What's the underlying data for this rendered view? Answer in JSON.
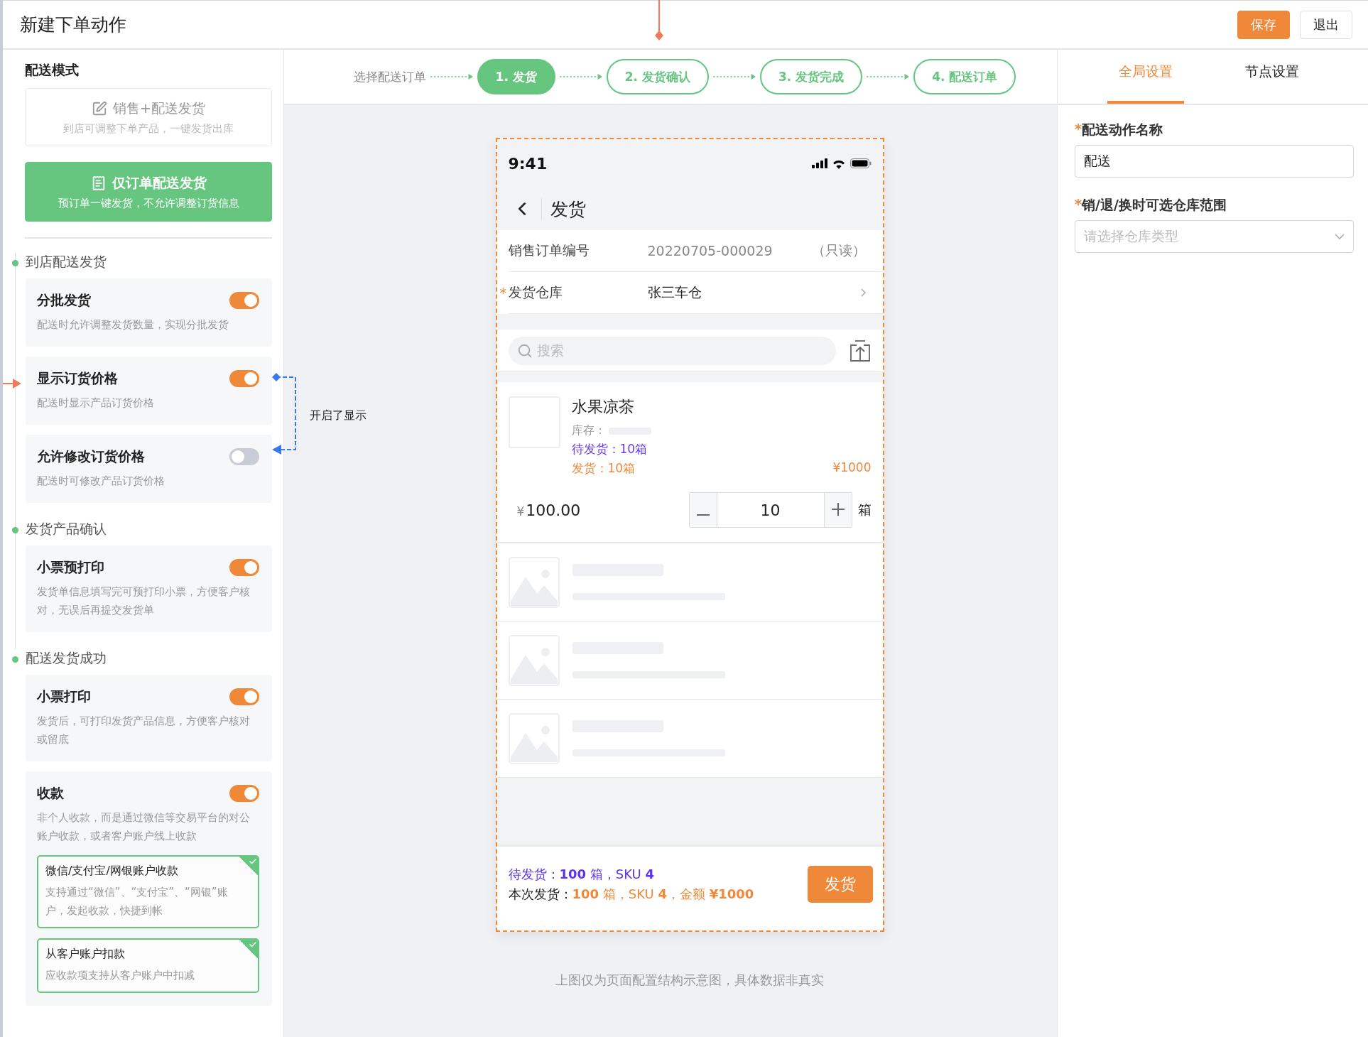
{
  "header": {
    "title": "新建下单动作",
    "buttons": [
      {
        "label": "保存",
        "kind": "primary"
      },
      {
        "label": "退出",
        "kind": "default"
      }
    ]
  },
  "left": {
    "mode_label": "配送模式",
    "modes": [
      {
        "title": "销售+配送发货",
        "desc": "到店可调整下单产品，一键发货出库",
        "selected": false,
        "kind": "edit"
      },
      {
        "title": "仅订单配送发货",
        "desc": "预订单一键发货，不允许调整订货信息",
        "selected": true,
        "kind": "receipt"
      }
    ],
    "sections": [
      {
        "label": "到店配送发货",
        "items": [
          {
            "title": "分批发货",
            "desc": "配送时允许调整发货数量，实现分批发货",
            "on": true
          },
          {
            "title": "显示订货价格",
            "desc": "配送时显示产品订货价格",
            "on": true
          },
          {
            "title": "允许修改订货价格",
            "desc": "配送时可修改产品订货价格",
            "on": false
          }
        ]
      },
      {
        "label": "发货产品确认",
        "items": [
          {
            "title": "小票预打印",
            "desc": "发货单信息填写完可预打印小票，方便客户核对，无误后再提交发货单",
            "on": true
          }
        ]
      },
      {
        "label": "配送发货成功",
        "items": [
          {
            "title": "小票打印",
            "desc": "发货后，可打印发货产品信息，方便客户核对或留底",
            "on": true
          },
          {
            "title": "收款",
            "desc": "非个人收款，而是通过微信等交易平台的对公账户收款，或者客户账户线上收款",
            "on": true,
            "options": [
              {
                "title": "微信/支付宝/网银账户收款",
                "desc": "支持通过“微信”、“支付宝”、“网银”账户，发起收款，快捷到帐",
                "checked": true
              },
              {
                "title": "从客户账户扣款",
                "desc": "应收款项支持从客户账户中扣减",
                "checked": true
              }
            ]
          }
        ]
      }
    ]
  },
  "annotations": {
    "callout": "开启了显示"
  },
  "steps": {
    "prefix": "选择配送订单",
    "items": [
      {
        "label": "1. 发货",
        "selected": true
      },
      {
        "label": "2. 发货确认",
        "selected": false
      },
      {
        "label": "3. 发货完成",
        "selected": false
      },
      {
        "label": "4. 配送订单",
        "selected": false
      }
    ]
  },
  "phone": {
    "time": "9:41",
    "nav_title": "发货",
    "rows": [
      {
        "label": "销售订单编号",
        "value": "20220705-000029",
        "note": "（只读）",
        "kind": "readonly"
      },
      {
        "label": "发货仓库",
        "value": "张三车仓",
        "required_mark": "*",
        "kind": "select"
      }
    ],
    "search": {
      "placeholder": "搜索"
    },
    "product": {
      "name": "水果凉茶",
      "stock_label": "库存：",
      "pending": "待发货：10箱",
      "shipped": "发货：10箱",
      "amount": "¥1000",
      "currency": "¥",
      "price": "100.00",
      "quantity": "10",
      "unit": "箱"
    },
    "footer": {
      "pending": "待发货：**100** 箱，SKU **4**",
      "shipped_label": "本次发货：",
      "shipped": "**100** 箱，SKU **4**，金额 **¥1000**",
      "button": "发货"
    }
  },
  "note": "上图仅为页面配置结构示意图，具体数据非真实",
  "right": {
    "tabs": [
      {
        "label": "全局设置",
        "selected": true
      },
      {
        "label": "节点设置",
        "selected": false
      }
    ],
    "fields": [
      {
        "label": "配送动作名称",
        "required_mark": "*",
        "kind": "input",
        "value": "配送"
      },
      {
        "label": "销/退/换时可选仓库范围",
        "required_mark": "*",
        "kind": "select",
        "placeholder": "请选择仓库类型"
      }
    ]
  }
}
